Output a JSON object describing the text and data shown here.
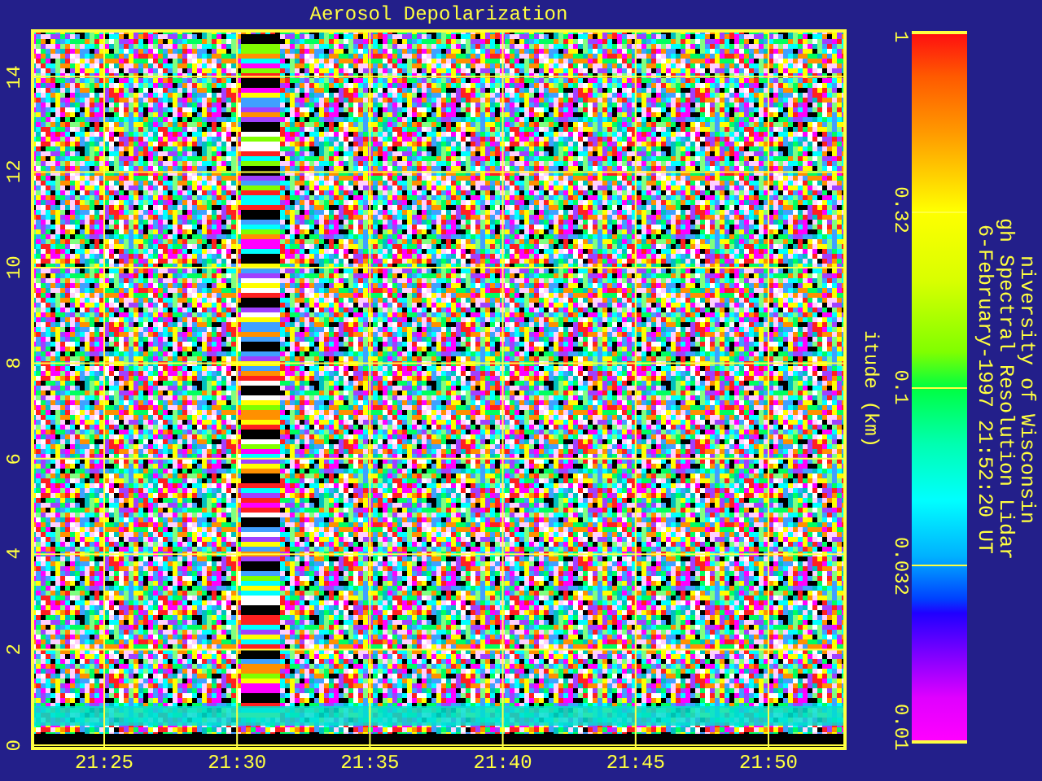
{
  "title": "Aerosol Depolarization",
  "y_axis": {
    "title": "itude (km)",
    "ticks": [
      "0",
      "2",
      "4",
      "6",
      "8",
      "10",
      "12",
      "14"
    ]
  },
  "x_axis": {
    "ticks": [
      "21:25",
      "21:30",
      "21:35",
      "21:40",
      "21:45",
      "21:50"
    ]
  },
  "colorbar": {
    "labels": [
      "1",
      "0.32",
      "0.1",
      "0.032",
      "0.01"
    ]
  },
  "caption": [
    "niversity of Wisconsin",
    "gh Spectral Resolution Lidar",
    "6-February-1997 21:52:20 UT"
  ]
}
